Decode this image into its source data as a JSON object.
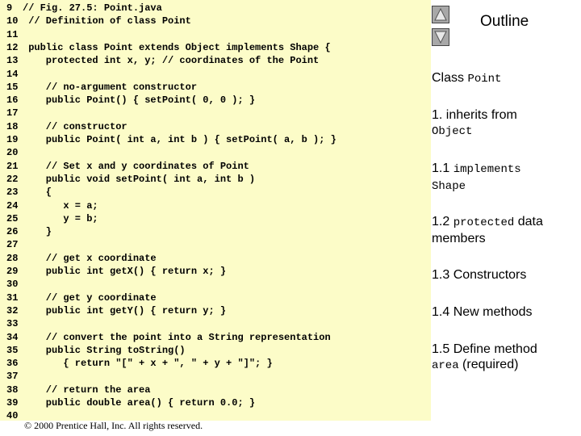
{
  "code_lines": [
    {
      "num": "9",
      "text": "// Fig. 27.5: Point.java"
    },
    {
      "num": "10",
      "text": " // Definition of class Point"
    },
    {
      "num": "11",
      "text": ""
    },
    {
      "num": "12",
      "text": " public class Point extends Object implements Shape {"
    },
    {
      "num": "13",
      "text": "    protected int x, y; // coordinates of the Point"
    },
    {
      "num": "14",
      "text": ""
    },
    {
      "num": "15",
      "text": "    // no-argument constructor"
    },
    {
      "num": "16",
      "text": "    public Point() { setPoint( 0, 0 ); }"
    },
    {
      "num": "17",
      "text": ""
    },
    {
      "num": "18",
      "text": "    // constructor"
    },
    {
      "num": "19",
      "text": "    public Point( int a, int b ) { setPoint( a, b ); }"
    },
    {
      "num": "20",
      "text": ""
    },
    {
      "num": "21",
      "text": "    // Set x and y coordinates of Point"
    },
    {
      "num": "22",
      "text": "    public void setPoint( int a, int b )"
    },
    {
      "num": "23",
      "text": "    {"
    },
    {
      "num": "24",
      "text": "       x = a;"
    },
    {
      "num": "25",
      "text": "       y = b;"
    },
    {
      "num": "26",
      "text": "    }"
    },
    {
      "num": "27",
      "text": ""
    },
    {
      "num": "28",
      "text": "    // get x coordinate"
    },
    {
      "num": "29",
      "text": "    public int getX() { return x; }"
    },
    {
      "num": "30",
      "text": ""
    },
    {
      "num": "31",
      "text": "    // get y coordinate"
    },
    {
      "num": "32",
      "text": "    public int getY() { return y; }"
    },
    {
      "num": "33",
      "text": ""
    },
    {
      "num": "34",
      "text": "    // convert the point into a String representation"
    },
    {
      "num": "35",
      "text": "    public String toString()"
    },
    {
      "num": "36",
      "text": "       { return \"[\" + x + \", \" + y + \"]\"; }"
    },
    {
      "num": "37",
      "text": ""
    },
    {
      "num": "38",
      "text": "    // return the area"
    },
    {
      "num": "39",
      "text": "    public double area() { return 0.0; }"
    },
    {
      "num": "40",
      "text": ""
    }
  ],
  "copyright": "© 2000 Prentice Hall, Inc.  All rights reserved.",
  "nav": {
    "up_icon": "triangle-up-icon",
    "down_icon": "triangle-down-icon"
  },
  "outline": {
    "title": "Outline",
    "class_label": "Class ",
    "class_name": "Point",
    "item1_prefix": "1. inherits from",
    "item1_code": "Object",
    "item2_prefix": "1.1 ",
    "item2_code": "implements",
    "item2_code2": "Shape",
    "item3_prefix": "1.2 ",
    "item3_code": "protected",
    "item3_suffix": " data members",
    "item4": "1.3 Constructors",
    "item5": "1.4 New methods",
    "item6_prefix": "1.5 Define method",
    "item6_code": "area",
    "item6_suffix": " (required)"
  },
  "colors": {
    "code_bg": "#fcfcc8",
    "nav_btn": "#a8a8a8"
  }
}
